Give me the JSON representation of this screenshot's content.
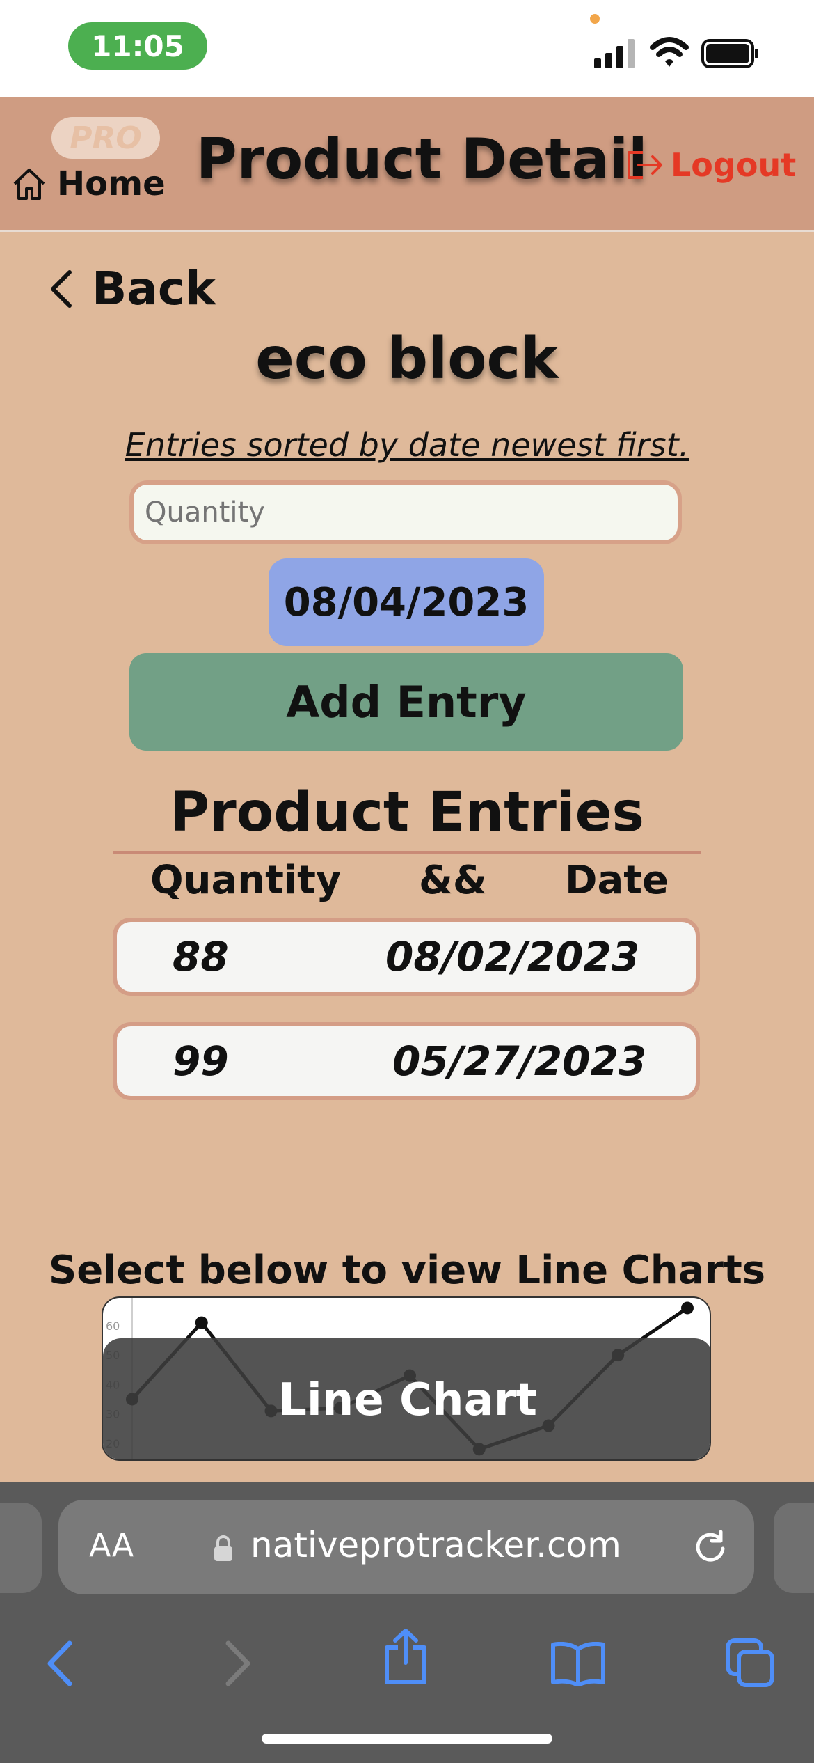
{
  "status_bar": {
    "time": "11:05"
  },
  "header": {
    "logo_text": "PRO",
    "home_label": "Home",
    "title": "Product Detail",
    "logout_label": "Logout"
  },
  "product": {
    "back_label": "Back",
    "name": "eco block",
    "sort_note": "Entries sorted by date newest first.",
    "quantity_placeholder": "Quantity",
    "date_value": "08/04/2023",
    "add_entry_label": "Add Entry"
  },
  "entries": {
    "title": "Product Entries",
    "headers": {
      "quantity": "Quantity",
      "separator": "&&",
      "date": "Date"
    },
    "rows": [
      {
        "quantity": "88",
        "date": "08/02/2023"
      },
      {
        "quantity": "99",
        "date": "05/27/2023"
      }
    ]
  },
  "charts": {
    "select_note": "Select below to view Line Charts",
    "button_label": "Line Chart",
    "ytick_labels": [
      "60",
      "50",
      "40",
      "30",
      "20"
    ],
    "thumbnail_values": [
      35,
      61,
      31,
      32,
      43,
      18,
      26,
      50,
      66
    ]
  },
  "browser": {
    "aa_label": "AA",
    "url": "nativeprotracker.com"
  },
  "colors": {
    "background": "#dfb99a",
    "header": "#cf9c82",
    "date_button": "#8fa5e6",
    "add_button": "#72a086",
    "logout": "#e53925",
    "browser_accent": "#4f8ef7"
  }
}
